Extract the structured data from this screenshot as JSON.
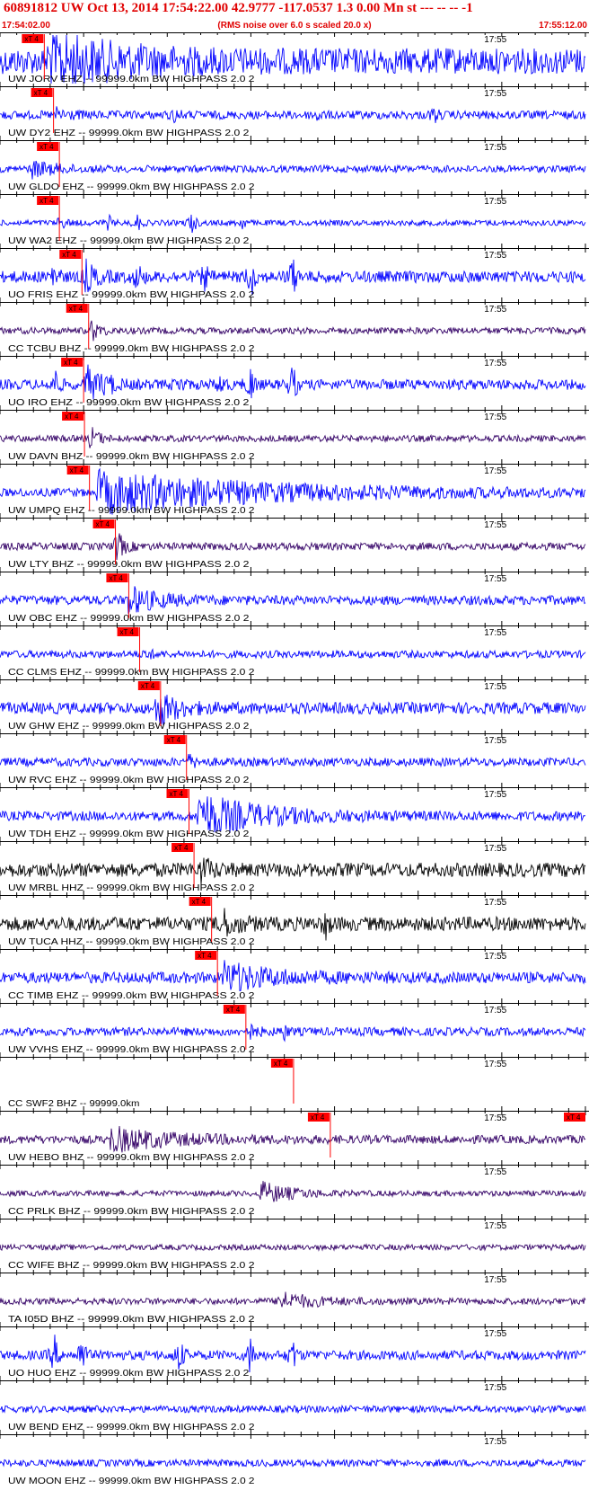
{
  "header": {
    "title": "60891812 UW Oct 13, 2014 17:54:22.00   42.9777 -117.0537  1.3 0.00 Mn st --- -- --  -1",
    "start_time": "17:54:02.00",
    "note": "(RMS noise over 6.0 s scaled 20.0 x)",
    "end_time": "17:55:12.00"
  },
  "chart_data": {
    "type": "line",
    "x_start": "17:54:02.00",
    "x_end": "17:55:12.00",
    "minute_label": "17:55",
    "pick_label": "xT 4",
    "colors": {
      "trace": "#0000ff",
      "pick": "#ff0000",
      "grid": "#000000"
    },
    "series": [
      {
        "label": "UW JORV EHZ -- 99999.0km BW  HIGHPASS  2.0  2",
        "color": "#0000ff",
        "pick_s": 5.3,
        "amp": 0.55,
        "burst": [
          5.5,
          14,
          1.0
        ],
        "events": [],
        "period": 0.9
      },
      {
        "label": "UW DY2 EHZ -- 99999.0km BW  HIGHPASS  2.0  2",
        "color": "#0000ff",
        "pick_s": 6.4,
        "amp": 0.18,
        "burst": [
          6.5,
          3,
          0.25
        ],
        "events": [
          [
            21,
            0.3
          ],
          [
            38,
            0.25
          ],
          [
            52,
            0.3
          ]
        ],
        "period": 0.9
      },
      {
        "label": "UW GLDO EHZ -- 99999.0km BW  HIGHPASS  2.0  2",
        "color": "#0000ff",
        "pick_s": 7.1,
        "amp": 0.15,
        "burst": [
          3.5,
          5,
          0.35
        ],
        "events": [],
        "period": 0.9
      },
      {
        "label": "UW WA2 EHZ -- 99999.0km BW  HIGHPASS  2.0  2",
        "color": "#0000ff",
        "pick_s": 7.1,
        "amp": 0.12,
        "burst": [
          6.8,
          1.5,
          0.3
        ],
        "events": [
          [
            13,
            0.3
          ],
          [
            16.5,
            0.35
          ],
          [
            23,
            0.5
          ],
          [
            29,
            0.25
          ]
        ],
        "period": 0.9
      },
      {
        "label": "UO FRIS EHZ -- 99999.0km BW  HIGHPASS  2.0  2",
        "color": "#0000ff",
        "pick_s": 9.8,
        "amp": 0.25,
        "burst": [
          9.8,
          2,
          0.9
        ],
        "events": [
          [
            6.5,
            0.7
          ],
          [
            16.5,
            0.6
          ],
          [
            24.5,
            0.5
          ],
          [
            30,
            0.9
          ],
          [
            35,
            0.8
          ]
        ],
        "period": 0.9
      },
      {
        "label": "CC TCBU BHZ -- 99999.0km BW  HIGHPASS  2.0  2",
        "color": "#330066",
        "pick_s": 10.6,
        "amp": 0.14,
        "burst": [
          10.7,
          1.5,
          0.6
        ],
        "events": [],
        "period": 0.9
      },
      {
        "label": "UO IRO EHZ -- 99999.0km BW  HIGHPASS  2.0  2",
        "color": "#0000ff",
        "pick_s": 10.0,
        "amp": 0.22,
        "burst": [
          10,
          3,
          0.9
        ],
        "events": [
          [
            6.7,
            0.6
          ],
          [
            13,
            0.4
          ],
          [
            21.5,
            0.4
          ],
          [
            26.5,
            0.5
          ],
          [
            30,
            0.8
          ],
          [
            35,
            0.9
          ]
        ],
        "period": 0.9
      },
      {
        "label": "UW DAVN BHZ -- 99999.0km BW  HIGHPASS  2.0  2",
        "color": "#330066",
        "pick_s": 10.1,
        "amp": 0.14,
        "burst": [
          10.6,
          1.5,
          0.7
        ],
        "events": [],
        "period": 0.9
      },
      {
        "label": "UW UMPQ EHZ -- 99999.0km BW  HIGHPASS  2.0  2",
        "color": "#0000ff",
        "pick_s": 10.7,
        "amp": 0.18,
        "burst": [
          11.5,
          35,
          0.85
        ],
        "events": [],
        "period": 0.9
      },
      {
        "label": "UW LTY BHZ -- 99999.0km BW  HIGHPASS  2.0  2",
        "color": "#330066",
        "pick_s": 13.8,
        "amp": 0.16,
        "burst": [
          13.6,
          1.5,
          0.95
        ],
        "events": [],
        "period": 0.9
      },
      {
        "label": "UW OBC EHZ -- 99999.0km BW  HIGHPASS  2.0  2",
        "color": "#0000ff",
        "pick_s": 15.4,
        "amp": 0.2,
        "burst": [
          15,
          6,
          0.6
        ],
        "events": [],
        "period": 0.9
      },
      {
        "label": "CC CLMS EHZ -- 99999.0km BW  HIGHPASS  2.0  2",
        "color": "#0000ff",
        "pick_s": 16.7,
        "amp": 0.16,
        "burst": [
          17.1,
          1,
          0.45
        ],
        "events": [],
        "period": 0.9
      },
      {
        "label": "UW GHW EHZ -- 99999.0km BW  HIGHPASS  2.0  2",
        "color": "#0000ff",
        "pick_s": 19.2,
        "amp": 0.25,
        "burst": [
          18.5,
          4,
          0.8
        ],
        "events": [],
        "period": 0.9
      },
      {
        "label": "UW RVC EHZ -- 99999.0km BW  HIGHPASS  2.0  2",
        "color": "#0000ff",
        "pick_s": 22.3,
        "amp": 0.18,
        "burst": [
          22.2,
          1.5,
          0.35
        ],
        "events": [],
        "period": 0.9
      },
      {
        "label": "UW TDH EHZ -- 99999.0km BW  HIGHPASS  2.0  2",
        "color": "#0000ff",
        "pick_s": 22.6,
        "amp": 0.2,
        "burst": [
          23.5,
          13,
          0.95
        ],
        "events": [],
        "period": 2.2
      },
      {
        "label": "UW MRBL HHZ -- 99999.0km BW  HIGHPASS  2.0  2",
        "color": "#000000",
        "pick_s": 23.2,
        "amp": 0.3,
        "burst": [
          23.8,
          2,
          0.6
        ],
        "events": [],
        "period": 0.9
      },
      {
        "label": "UW TUCA HHZ -- 99999.0km BW  HIGHPASS  2.0  2",
        "color": "#000000",
        "pick_s": 25.3,
        "amp": 0.3,
        "burst": [
          26,
          3,
          0.7
        ],
        "events": [
          [
            39,
            0.5
          ]
        ],
        "period": 0.9
      },
      {
        "label": "CC TIMB EHZ -- 99999.0km BW  HIGHPASS  2.0  2",
        "color": "#0000ff",
        "pick_s": 26.0,
        "amp": 0.24,
        "burst": [
          26.5,
          10,
          0.6
        ],
        "events": [],
        "period": 0.9
      },
      {
        "label": "UW VVHS EHZ -- 99999.0km BW  HIGHPASS  2.0  2",
        "color": "#0000ff",
        "pick_s": 29.4,
        "amp": 0.18,
        "burst": [
          29.3,
          1.5,
          0.5
        ],
        "events": [
          [
            34,
            0.3
          ]
        ],
        "period": 0.9
      },
      {
        "label": "CC SWF2 BHZ -- 99999.0km",
        "color": "#0000ff",
        "pick_s": 35.1,
        "amp": 0.0,
        "burst": [
          0,
          0,
          0
        ],
        "events": [],
        "period": 0.9,
        "flat": true
      },
      {
        "label": "UW HEBO BHZ -- 99999.0km BW  HIGHPASS  2.0  2",
        "color": "#330066",
        "pick_s": 39.5,
        "amp": 0.18,
        "burst": [
          13,
          12,
          0.5
        ],
        "events": [],
        "period": 0.9
      },
      {
        "label": "CC PRLK BHZ -- 99999.0km BW  HIGHPASS  2.0  2",
        "color": "#330066",
        "pick_s": null,
        "amp": 0.12,
        "burst": [
          31,
          6,
          0.5
        ],
        "events": [],
        "period": 0.9
      },
      {
        "label": "CC WIFE BHZ -- 99999.0km BW  HIGHPASS  2.0  2",
        "color": "#330066",
        "pick_s": null,
        "amp": 0.12,
        "burst": [
          0,
          0,
          0
        ],
        "events": [],
        "period": 0.9
      },
      {
        "label": "TA I05D BHZ -- 99999.0km BW  HIGHPASS  2.0  2",
        "color": "#330066",
        "pick_s": null,
        "amp": 0.14,
        "burst": [
          33,
          7,
          0.4
        ],
        "events": [],
        "period": 0.9
      },
      {
        "label": "UO HUO EHZ -- 99999.0km BW  HIGHPASS  2.0  2",
        "color": "#0000ff",
        "pick_s": null,
        "amp": 0.2,
        "burst": [
          0,
          0,
          0
        ],
        "events": [
          [
            6.5,
            0.8
          ],
          [
            9.8,
            0.9
          ],
          [
            21.5,
            0.8
          ],
          [
            30,
            0.9
          ],
          [
            35,
            0.7
          ]
        ],
        "period": 0.9
      },
      {
        "label": "UW BEND EHZ -- 99999.0km BW  HIGHPASS  2.0  2",
        "color": "#0000ff",
        "pick_s": null,
        "amp": 0.15,
        "burst": [
          0,
          0,
          0
        ],
        "events": [],
        "period": 0.9
      },
      {
        "label": "UW MOON EHZ -- 99999.0km BW  HIGHPASS  2.0  2",
        "color": "#0000ff",
        "pick_s": null,
        "amp": 0.15,
        "burst": [
          0,
          0,
          0
        ],
        "events": [],
        "period": 0.9
      }
    ]
  }
}
